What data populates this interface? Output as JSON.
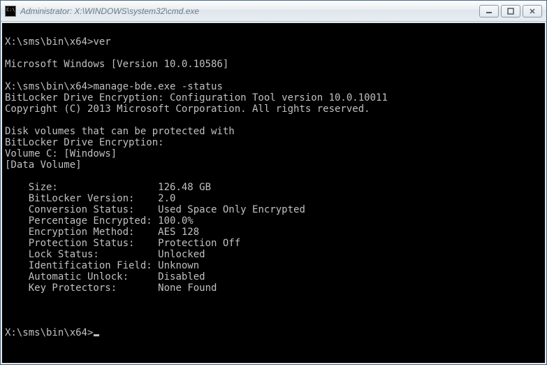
{
  "window": {
    "title": "Administrator: X:\\WINDOWS\\system32\\cmd.exe"
  },
  "terminal": {
    "prompt1": "X:\\sms\\bin\\x64>",
    "cmd1": "ver",
    "blank1": "",
    "ver_output": "Microsoft Windows [Version 10.0.10586]",
    "blank2": "",
    "prompt2": "X:\\sms\\bin\\x64>",
    "cmd2": "manage-bde.exe -status",
    "header1": "BitLocker Drive Encryption: Configuration Tool version 10.0.10011",
    "header2": "Copyright (C) 2013 Microsoft Corporation. All rights reserved.",
    "blank3": "",
    "info1": "Disk volumes that can be protected with",
    "info2": "BitLocker Drive Encryption:",
    "vol_line": "Volume C: [Windows]",
    "vol_type": "[Data Volume]",
    "blank4": "",
    "kv": [
      {
        "label": "Size:",
        "pad": "                 ",
        "value": "126.48 GB"
      },
      {
        "label": "BitLocker Version:",
        "pad": "    ",
        "value": "2.0"
      },
      {
        "label": "Conversion Status:",
        "pad": "    ",
        "value": "Used Space Only Encrypted"
      },
      {
        "label": "Percentage Encrypted:",
        "pad": " ",
        "value": "100.0%"
      },
      {
        "label": "Encryption Method:",
        "pad": "    ",
        "value": "AES 128"
      },
      {
        "label": "Protection Status:",
        "pad": "    ",
        "value": "Protection Off"
      },
      {
        "label": "Lock Status:",
        "pad": "          ",
        "value": "Unlocked"
      },
      {
        "label": "Identification Field:",
        "pad": " ",
        "value": "Unknown"
      },
      {
        "label": "Automatic Unlock:",
        "pad": "     ",
        "value": "Disabled"
      },
      {
        "label": "Key Protectors:",
        "pad": "       ",
        "value": "None Found"
      }
    ],
    "blank5": "",
    "blank6": "",
    "prompt3": "X:\\sms\\bin\\x64>",
    "indent": "    "
  }
}
